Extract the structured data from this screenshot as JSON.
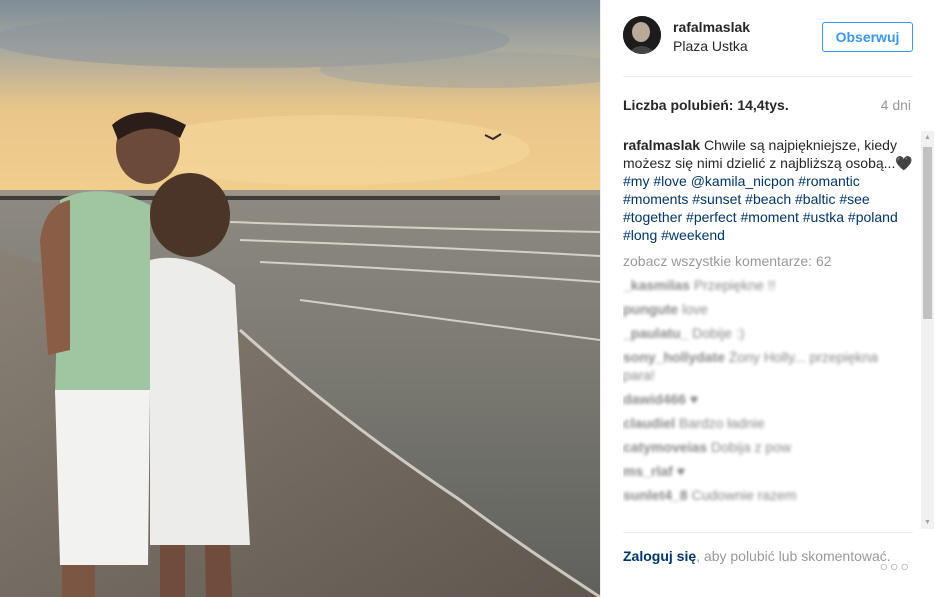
{
  "post": {
    "username": "rafalmaslak",
    "location": "Plaza Ustka",
    "follow_label": "Obserwuj",
    "likes_text": "Liczba polubień: 14,4tys.",
    "age": "4 dni",
    "caption_user": "rafalmaslak",
    "caption_text": " Chwile są najpiękniejsze, kiedy możesz się nimi dzielić z najbliższą osobą...🖤 ",
    "hashtags": "#my #love @kamila_nicpon #romantic #moments #sunset #beach #baltic #see #together #perfect #moment #ustka #poland #long #weekend",
    "view_all": "zobacz wszystkie komentarze: 62",
    "comments": [
      {
        "user": "_kasmilas",
        "text": "Przepiękne !!"
      },
      {
        "user": "pungute",
        "text": "love"
      },
      {
        "user": "_paulatu_",
        "text": "Dobije :)"
      },
      {
        "user": "sony_hollydate",
        "text": "Żony Holly... przepiękna para!"
      },
      {
        "user": "dawid466",
        "text": "♥"
      },
      {
        "user": "claudiel",
        "text": "Bardzo ładnie"
      },
      {
        "user": "catymoveias",
        "text": "Dobija z pow"
      },
      {
        "user": "ms_rlaf",
        "text": "♥"
      },
      {
        "user": "sunlet4_8",
        "text": "Cudownie razem"
      }
    ],
    "login_link": "Zaloguj się",
    "login_rest": ", aby polubić lub skomentować.",
    "more_label": "○○○"
  },
  "icons": {
    "scroll_up": "scroll-up-arrow-icon",
    "scroll_down": "scroll-down-arrow-icon"
  },
  "colors": {
    "link": "#003569",
    "follow_blue": "#3897f0",
    "muted": "#999999"
  }
}
